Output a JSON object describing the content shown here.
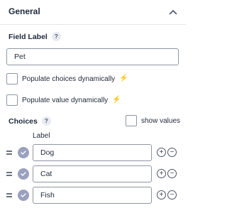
{
  "section": {
    "title": "General"
  },
  "field_label": {
    "label": "Field Label",
    "help": "?",
    "value": "Pet"
  },
  "options": {
    "populate_choices": {
      "label": "Populate choices dynamically",
      "checked": false,
      "icon": "bolt-icon",
      "icon_color": "#f97316"
    },
    "populate_values": {
      "label": "Populate value dynamically",
      "checked": false,
      "icon": "bolt-icon",
      "icon_color": "#3b82f6"
    }
  },
  "choices": {
    "label": "Choices",
    "help": "?",
    "show_values_label": "show values",
    "show_values_checked": false,
    "column_label": "Label",
    "items": [
      {
        "value": "Dog",
        "default": true
      },
      {
        "value": "Cat",
        "default": true
      },
      {
        "value": "Fish",
        "default": true
      }
    ],
    "add_symbol": "+",
    "remove_symbol": "−"
  },
  "colors": {
    "accent_check": "#9aa1bf",
    "border": "#8f96a3"
  }
}
